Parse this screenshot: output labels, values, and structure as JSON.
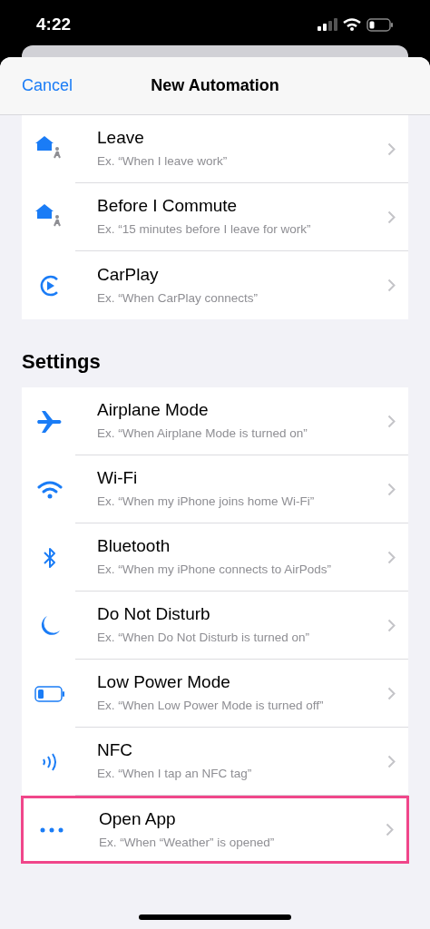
{
  "status_bar": {
    "time": "4:22"
  },
  "nav": {
    "cancel": "Cancel",
    "title": "New Automation"
  },
  "sections": [
    {
      "items": [
        {
          "kind": "home",
          "title": "Leave",
          "subtitle": "Ex. “When I leave work”",
          "highlighted": false
        },
        {
          "kind": "home",
          "title": "Before I Commute",
          "subtitle": "Ex. “15 minutes before I leave for work”",
          "highlighted": false
        },
        {
          "kind": "carplay",
          "title": "CarPlay",
          "subtitle": "Ex. “When CarPlay connects”",
          "highlighted": false
        }
      ]
    },
    {
      "header": "Settings",
      "items": [
        {
          "kind": "airplane",
          "title": "Airplane Mode",
          "subtitle": "Ex. “When Airplane Mode is turned on”",
          "highlighted": false
        },
        {
          "kind": "wifi",
          "title": "Wi-Fi",
          "subtitle": "Ex. “When my iPhone joins home Wi-Fi”",
          "highlighted": false
        },
        {
          "kind": "bluetooth",
          "title": "Bluetooth",
          "subtitle": "Ex. “When my iPhone connects to AirPods”",
          "highlighted": false
        },
        {
          "kind": "moon",
          "title": "Do Not Disturb",
          "subtitle": "Ex. “When Do Not Disturb is turned on”",
          "highlighted": false
        },
        {
          "kind": "battery",
          "title": "Low Power Mode",
          "subtitle": "Ex. “When Low Power Mode is turned off”",
          "highlighted": false
        },
        {
          "kind": "nfc",
          "title": "NFC",
          "subtitle": "Ex. “When I tap an NFC tag”",
          "highlighted": false
        },
        {
          "kind": "dots",
          "title": "Open App",
          "subtitle": "Ex. “When “Weather” is opened”",
          "highlighted": true
        }
      ]
    }
  ]
}
